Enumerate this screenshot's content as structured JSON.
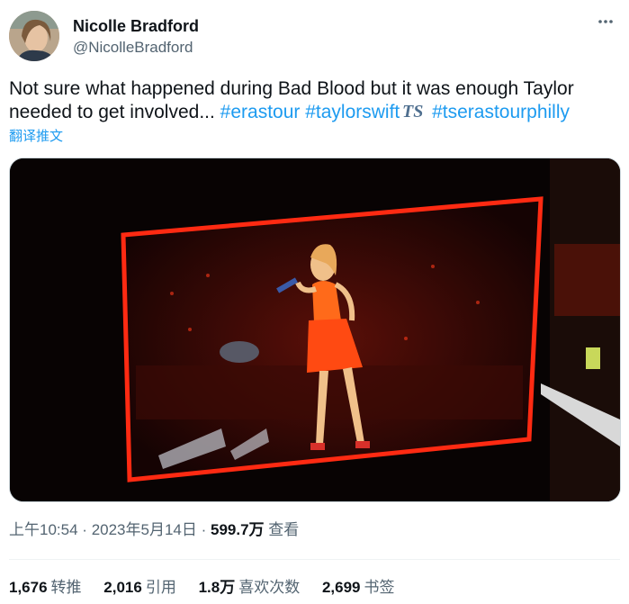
{
  "author": {
    "name": "Nicolle Bradford",
    "handle": "@NicolleBradford"
  },
  "more_icon": "more-horizontal-icon",
  "tweet": {
    "text_prefix": "Not sure what happened during Bad Blood but it was enough Taylor needed to get involved... ",
    "hashtags": [
      "#erastour",
      "#taylorswift",
      "#tserastourphilly"
    ],
    "emoji_icon": "ts-logo-icon",
    "translate_link": "翻译推文"
  },
  "meta": {
    "time": "上午10:54",
    "separator": "·",
    "date": "2023年5月14日",
    "views": "599.7万",
    "views_label": "查看"
  },
  "stats": {
    "retweets": {
      "count": "1,676",
      "label": "转推"
    },
    "quotes": {
      "count": "2,016",
      "label": "引用"
    },
    "likes": {
      "count": "1.8万",
      "label": "喜欢次数"
    },
    "bookmarks": {
      "count": "2,699",
      "label": "书签"
    }
  },
  "colors": {
    "link": "#1d9bf0",
    "secondary_text": "#536471",
    "stage_red": "#ff2a12"
  }
}
